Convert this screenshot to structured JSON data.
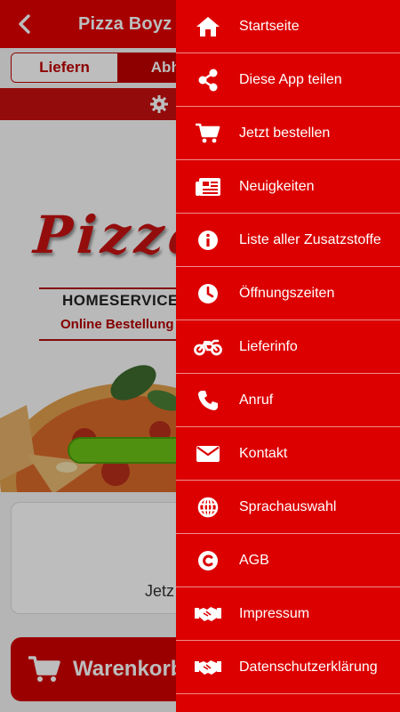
{
  "header": {
    "title": "Pizza Boyz M",
    "back_icon": "chevron-left-icon"
  },
  "order_mode": {
    "options": [
      "Liefern",
      "Abho"
    ],
    "selected": "Abho"
  },
  "hero": {
    "logo_text": "Pizza",
    "line1": "HOMESERVICE",
    "line2": "Online Bestellung"
  },
  "card": {
    "text": "Jetz"
  },
  "cart": {
    "label": "Warenkorb",
    "icon": "cart-icon"
  },
  "drawer": {
    "items": [
      {
        "label": "Startseite",
        "icon": "home-icon"
      },
      {
        "label": "Diese App teilen",
        "icon": "share-icon"
      },
      {
        "label": "Jetzt bestellen",
        "icon": "cart-icon"
      },
      {
        "label": "Neuigkeiten",
        "icon": "newspaper-icon"
      },
      {
        "label": "Liste aller Zusatzstoffe",
        "icon": "info-icon"
      },
      {
        "label": "Öffnungszeiten",
        "icon": "clock-icon"
      },
      {
        "label": "Lieferinfo",
        "icon": "motorcycle-icon"
      },
      {
        "label": "Anruf",
        "icon": "phone-icon"
      },
      {
        "label": "Kontakt",
        "icon": "envelope-icon"
      },
      {
        "label": "Sprachauswahl",
        "icon": "globe-icon"
      },
      {
        "label": "AGB",
        "icon": "copyright-icon"
      },
      {
        "label": "Impressum",
        "icon": "handshake-icon"
      },
      {
        "label": "Datenschutzerklärung",
        "icon": "handshake-icon"
      }
    ]
  },
  "colors": {
    "primary_red": "#dc0000",
    "header_red": "#e10000",
    "accent_green": "#6cc318"
  }
}
